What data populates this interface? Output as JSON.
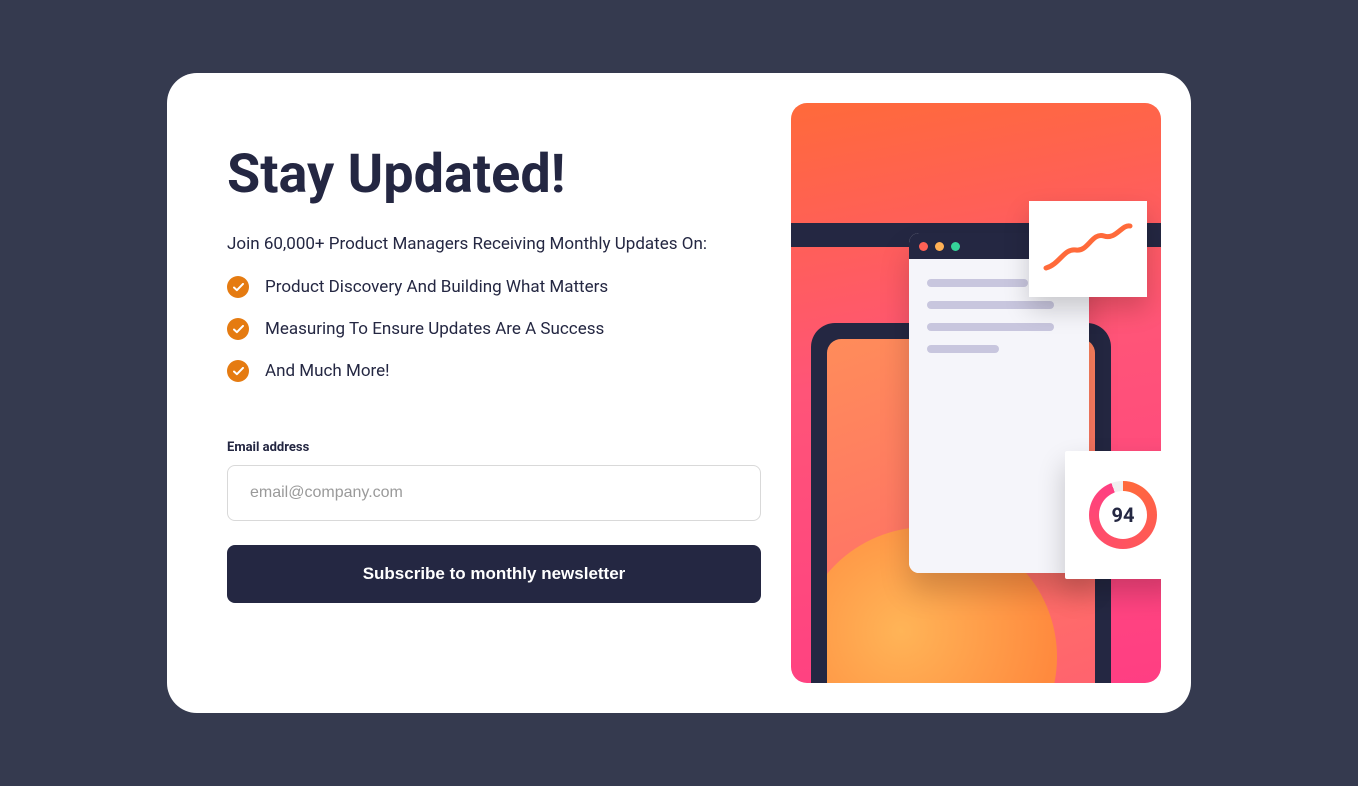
{
  "form": {
    "title": "Stay Updated!",
    "subtitle": "Join 60,000+ Product Managers Receiving Monthly Updates On:",
    "features": [
      "Product Discovery And Building What Matters",
      "Measuring To Ensure Updates Are A Success",
      "And Much More!"
    ],
    "email_label": "Email address",
    "email_placeholder": "email@company.com",
    "submit_label": "Subscribe to monthly newsletter"
  },
  "illustration": {
    "score": "94"
  }
}
